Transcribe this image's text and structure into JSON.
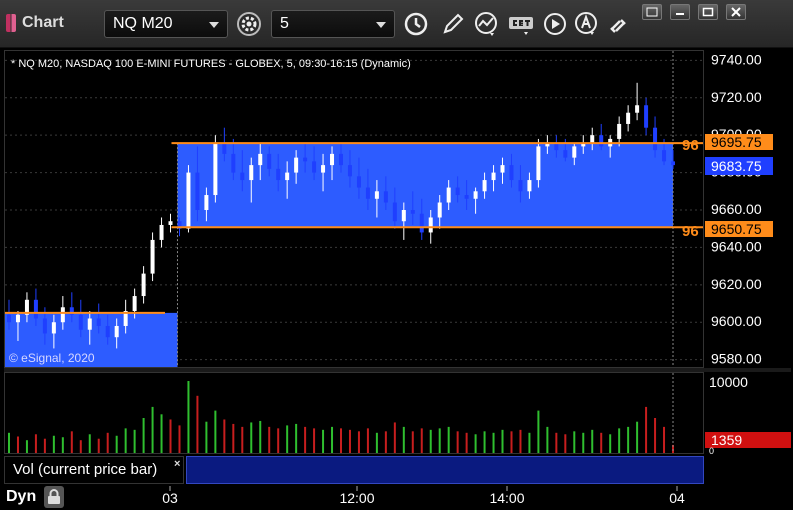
{
  "window": {
    "title": "Chart",
    "symbol": "NQ M20",
    "interval": "5"
  },
  "chart": {
    "header": "* NQ M20, NASDAQ 100 E-MINI FUTURES - GLOBEX, 5, 09:30-16:15 (Dynamic)",
    "watermark": "© eSignal, 2020",
    "price_ticks": [
      "9740.00",
      "9720.00",
      "9700.00",
      "9680.00",
      "9660.00",
      "9640.00",
      "9620.00",
      "9600.00",
      "9580.00"
    ],
    "time_ticks": [
      "03",
      "12:00",
      "14:00",
      "04"
    ],
    "current_price": "9683.75",
    "upper_level": "9695.75",
    "lower_level": "9650.75",
    "level_left_prefix": "96",
    "volume_ticks": [
      "10000",
      "0"
    ],
    "current_volume": "1359",
    "study_label": "Vol (current price bar)",
    "study_close": "×",
    "dyn_label": "Dyn",
    "colors": {
      "up_bar": "#ffffff",
      "down_bar": "#1f3fff",
      "zone": "#2d5cff",
      "level_line": "#ff8c1a",
      "vol_up": "#2fbf2f",
      "vol_down": "#c81e1e",
      "current_price_bg": "#1f3fff",
      "current_volume_bg": "#d01010"
    }
  },
  "chart_data": {
    "type": "candlestick",
    "title": "* NQ M20, NASDAQ 100 E-MINI FUTURES - GLOBEX, 5, 09:30-16:15 (Dynamic)",
    "ylim": [
      9575,
      9745
    ],
    "x_ticks": [
      "03",
      "12:00",
      "14:00",
      "04"
    ],
    "levels": [
      {
        "value": 9695.75
      },
      {
        "value": 9650.75
      },
      {
        "value": 9683.75
      }
    ],
    "ohlc": [
      [
        9604,
        9612,
        9596,
        9600
      ],
      [
        9600,
        9606,
        9590,
        9604
      ],
      [
        9604,
        9616,
        9600,
        9612
      ],
      [
        9612,
        9618,
        9598,
        9602
      ],
      [
        9602,
        9608,
        9588,
        9594
      ],
      [
        9594,
        9604,
        9586,
        9600
      ],
      [
        9600,
        9614,
        9596,
        9608
      ],
      [
        9608,
        9616,
        9600,
        9604
      ],
      [
        9604,
        9612,
        9592,
        9596
      ],
      [
        9596,
        9606,
        9588,
        9602
      ],
      [
        9602,
        9610,
        9594,
        9598
      ],
      [
        9598,
        9604,
        9588,
        9592
      ],
      [
        9592,
        9602,
        9586,
        9598
      ],
      [
        9598,
        9612,
        9594,
        9606
      ],
      [
        9606,
        9618,
        9602,
        9614
      ],
      [
        9614,
        9630,
        9610,
        9626
      ],
      [
        9626,
        9648,
        9622,
        9644
      ],
      [
        9644,
        9656,
        9640,
        9652
      ],
      [
        9652,
        9658,
        9648,
        9654
      ],
      [
        9654,
        9656,
        9646,
        9650
      ],
      [
        9650,
        9684,
        9648,
        9680
      ],
      [
        9680,
        9694,
        9654,
        9660
      ],
      [
        9660,
        9672,
        9654,
        9668
      ],
      [
        9668,
        9700,
        9664,
        9696
      ],
      [
        9696,
        9704,
        9686,
        9690
      ],
      [
        9690,
        9698,
        9676,
        9680
      ],
      [
        9680,
        9692,
        9670,
        9676
      ],
      [
        9676,
        9688,
        9664,
        9684
      ],
      [
        9684,
        9696,
        9676,
        9690
      ],
      [
        9690,
        9694,
        9678,
        9682
      ],
      [
        9682,
        9690,
        9670,
        9676
      ],
      [
        9676,
        9686,
        9666,
        9680
      ],
      [
        9680,
        9692,
        9674,
        9688
      ],
      [
        9688,
        9696,
        9680,
        9686
      ],
      [
        9686,
        9694,
        9676,
        9680
      ],
      [
        9680,
        9690,
        9670,
        9684
      ],
      [
        9684,
        9694,
        9676,
        9690
      ],
      [
        9690,
        9696,
        9680,
        9684
      ],
      [
        9684,
        9692,
        9672,
        9678
      ],
      [
        9678,
        9688,
        9666,
        9672
      ],
      [
        9672,
        9682,
        9660,
        9666
      ],
      [
        9666,
        9676,
        9656,
        9670
      ],
      [
        9670,
        9678,
        9660,
        9664
      ],
      [
        9664,
        9672,
        9650,
        9654
      ],
      [
        9654,
        9664,
        9644,
        9660
      ],
      [
        9660,
        9670,
        9652,
        9658
      ],
      [
        9658,
        9666,
        9644,
        9648
      ],
      [
        9648,
        9660,
        9642,
        9656
      ],
      [
        9656,
        9668,
        9650,
        9664
      ],
      [
        9664,
        9676,
        9660,
        9672
      ],
      [
        9672,
        9678,
        9664,
        9668
      ],
      [
        9668,
        9676,
        9660,
        9666
      ],
      [
        9666,
        9672,
        9658,
        9670
      ],
      [
        9670,
        9680,
        9666,
        9676
      ],
      [
        9676,
        9684,
        9670,
        9680
      ],
      [
        9680,
        9688,
        9674,
        9684
      ],
      [
        9684,
        9690,
        9672,
        9676
      ],
      [
        9676,
        9684,
        9664,
        9670
      ],
      [
        9670,
        9680,
        9666,
        9676
      ],
      [
        9676,
        9698,
        9672,
        9694
      ],
      [
        9694,
        9700,
        9690,
        9696
      ],
      [
        9696,
        9700,
        9688,
        9692
      ],
      [
        9692,
        9698,
        9686,
        9688
      ],
      [
        9688,
        9696,
        9684,
        9694
      ],
      [
        9694,
        9700,
        9690,
        9696
      ],
      [
        9696,
        9704,
        9692,
        9700
      ],
      [
        9700,
        9706,
        9692,
        9694
      ],
      [
        9694,
        9700,
        9688,
        9698
      ],
      [
        9698,
        9710,
        9694,
        9706
      ],
      [
        9706,
        9716,
        9702,
        9712
      ],
      [
        9712,
        9728,
        9708,
        9716
      ],
      [
        9716,
        9720,
        9700,
        9704
      ],
      [
        9704,
        9710,
        9688,
        9692
      ],
      [
        9692,
        9698,
        9684,
        9686
      ],
      [
        9686,
        9692,
        9682,
        9684
      ]
    ],
    "volume": [
      [
        3000,
        0
      ],
      [
        2500,
        1
      ],
      [
        2000,
        0
      ],
      [
        2800,
        1
      ],
      [
        2200,
        1
      ],
      [
        2600,
        0
      ],
      [
        2400,
        0
      ],
      [
        3200,
        1
      ],
      [
        2000,
        1
      ],
      [
        2800,
        0
      ],
      [
        2200,
        1
      ],
      [
        3000,
        1
      ],
      [
        2600,
        0
      ],
      [
        3600,
        0
      ],
      [
        3400,
        0
      ],
      [
        5000,
        0
      ],
      [
        6500,
        0
      ],
      [
        5500,
        0
      ],
      [
        4800,
        1
      ],
      [
        4000,
        1
      ],
      [
        10000,
        0
      ],
      [
        8000,
        1
      ],
      [
        4500,
        0
      ],
      [
        6000,
        0
      ],
      [
        4800,
        1
      ],
      [
        4200,
        1
      ],
      [
        3800,
        1
      ],
      [
        4400,
        0
      ],
      [
        4600,
        0
      ],
      [
        3800,
        1
      ],
      [
        3600,
        1
      ],
      [
        4000,
        0
      ],
      [
        4200,
        0
      ],
      [
        3800,
        1
      ],
      [
        3600,
        1
      ],
      [
        3400,
        0
      ],
      [
        3800,
        0
      ],
      [
        3600,
        1
      ],
      [
        3400,
        1
      ],
      [
        3200,
        1
      ],
      [
        3600,
        1
      ],
      [
        3000,
        0
      ],
      [
        3200,
        1
      ],
      [
        4400,
        1
      ],
      [
        3800,
        0
      ],
      [
        3200,
        1
      ],
      [
        3600,
        1
      ],
      [
        3400,
        0
      ],
      [
        3600,
        0
      ],
      [
        3800,
        0
      ],
      [
        3200,
        1
      ],
      [
        3000,
        1
      ],
      [
        2800,
        0
      ],
      [
        3200,
        0
      ],
      [
        3000,
        0
      ],
      [
        3400,
        0
      ],
      [
        3200,
        1
      ],
      [
        3400,
        1
      ],
      [
        3000,
        0
      ],
      [
        6000,
        0
      ],
      [
        3800,
        0
      ],
      [
        3000,
        1
      ],
      [
        2800,
        1
      ],
      [
        3200,
        0
      ],
      [
        3000,
        0
      ],
      [
        3400,
        0
      ],
      [
        3000,
        1
      ],
      [
        2800,
        0
      ],
      [
        3600,
        0
      ],
      [
        3800,
        0
      ],
      [
        4500,
        0
      ],
      [
        6500,
        1
      ],
      [
        5000,
        1
      ],
      [
        3800,
        1
      ],
      [
        1359,
        1
      ]
    ]
  }
}
